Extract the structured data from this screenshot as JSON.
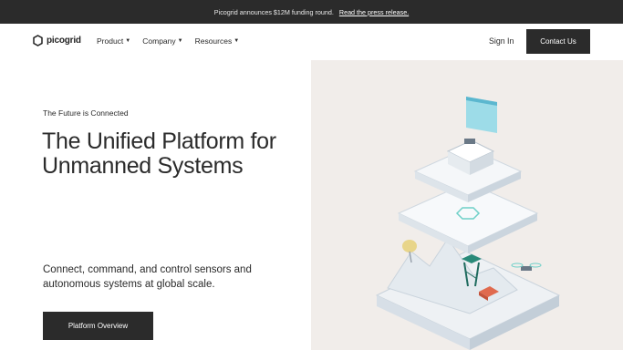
{
  "announcement": {
    "text": "Picogrid announces $12M funding round.",
    "link": "Read the press release."
  },
  "nav": {
    "logo_text": "picogrid",
    "menu": [
      {
        "label": "Product"
      },
      {
        "label": "Company"
      },
      {
        "label": "Resources"
      }
    ],
    "sign_in": "Sign In",
    "contact": "Contact Us"
  },
  "hero": {
    "eyebrow": "The Future is Connected",
    "headline": "The Unified Platform for Unmanned Systems",
    "description": "Connect, command, and control sensors and autonomous systems at global scale.",
    "cta": "Platform Overview"
  },
  "icons": {
    "logo": "hexagon-logo-icon",
    "caret": "chevron-down-icon"
  },
  "colors": {
    "dark": "#2b2b2b",
    "hero_bg": "#f1edea",
    "accent_teal": "#6fd0c8",
    "accent_red": "#e06a4e",
    "accent_yellow": "#e8d58a"
  }
}
